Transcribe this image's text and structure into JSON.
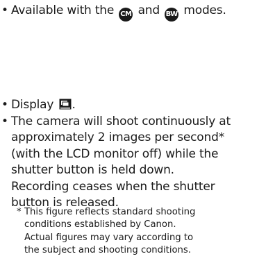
{
  "availability": {
    "prefix": "Available with the",
    "mode1_icon": "camera-mode-icon",
    "mode1_glyph": "CM",
    "conjunction": "and",
    "mode2_icon": "bw-mode-icon",
    "mode2_glyph": "BW",
    "suffix": "modes."
  },
  "steps": [
    {
      "lines": [
        "Display"
      ],
      "icon": "continuous-shooting-icon"
    },
    {
      "lines": [
        "The camera will shoot continuously at",
        "approximately 2 images per second*",
        "(with the LCD monitor off) while the",
        "shutter button is held down.",
        "Recording ceases when the shutter",
        "button is released."
      ]
    }
  ],
  "footnote": {
    "marker": "*",
    "lines": [
      "This figure reflects standard shooting",
      "conditions established by Canon.",
      "Actual figures may vary according to",
      "the subject and shooting conditions."
    ]
  }
}
